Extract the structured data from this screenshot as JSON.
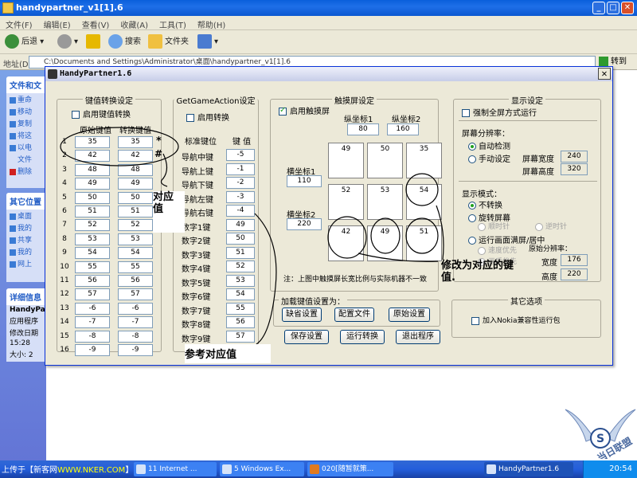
{
  "explorer": {
    "title": "handypartner_v1[1].6",
    "menu": [
      "文件(F)",
      "编辑(E)",
      "查看(V)",
      "收藏(A)",
      "工具(T)",
      "帮助(H)"
    ],
    "toolbar": {
      "back": "后退",
      "search": "搜索",
      "folders": "文件夹"
    },
    "address_label": "地址(D)",
    "address_value": "C:\\Documents and Settings\\Administrator\\桌面\\handypartner_v1[1].6",
    "go_label": "转到",
    "side": {
      "tasks_title": "文件和文",
      "tasks": [
        "重命",
        "移动",
        "复制",
        "将这",
        "以电",
        "文件",
        "删除"
      ],
      "other_title": "其它位置",
      "other": [
        "桌面",
        "我的",
        "共享",
        "我的",
        "网上"
      ],
      "details_title": "详细信息",
      "details": [
        "HandyPar",
        "应用程序",
        "修改日期",
        "15:28",
        "大小: 2"
      ]
    }
  },
  "app": {
    "title": "HandyPartner1.6",
    "keymap": {
      "group_title": "键值转换设定",
      "enable_label": "启用键值转换",
      "enabled": false,
      "col_original": "原始键值",
      "col_converted": "转换键值",
      "rows": [
        {
          "n": "1",
          "orig": "35",
          "conv": "35"
        },
        {
          "n": "2",
          "orig": "42",
          "conv": "42"
        },
        {
          "n": "3",
          "orig": "48",
          "conv": "48"
        },
        {
          "n": "4",
          "orig": "49",
          "conv": "49"
        },
        {
          "n": "5",
          "orig": "50",
          "conv": "50"
        },
        {
          "n": "6",
          "orig": "51",
          "conv": "51"
        },
        {
          "n": "7",
          "orig": "52",
          "conv": "52"
        },
        {
          "n": "8",
          "orig": "53",
          "conv": "53"
        },
        {
          "n": "9",
          "orig": "54",
          "conv": "54"
        },
        {
          "n": "10",
          "orig": "55",
          "conv": "55"
        },
        {
          "n": "11",
          "orig": "56",
          "conv": "56"
        },
        {
          "n": "12",
          "orig": "57",
          "conv": "57"
        },
        {
          "n": "13",
          "orig": "-6",
          "conv": "-6"
        },
        {
          "n": "14",
          "orig": "-7",
          "conv": "-7"
        },
        {
          "n": "15",
          "orig": "-8",
          "conv": "-8"
        },
        {
          "n": "16",
          "orig": "-9",
          "conv": "-9"
        }
      ]
    },
    "gameaction": {
      "group_title": "GetGameAction设定",
      "enable_label": "启用转换",
      "enabled": false,
      "col_key": "标准键位",
      "col_value": "键 值",
      "rows": [
        {
          "label": "导航中键",
          "value": "-5"
        },
        {
          "label": "导航上键",
          "value": "-1"
        },
        {
          "label": "导航下键",
          "value": "-2"
        },
        {
          "label": "导航左键",
          "value": "-3"
        },
        {
          "label": "导航右键",
          "value": "-4"
        },
        {
          "label": "数字1键",
          "value": "49"
        },
        {
          "label": "数字2键",
          "value": "50"
        },
        {
          "label": "数字3键",
          "value": "51"
        },
        {
          "label": "数字4键",
          "value": "52"
        },
        {
          "label": "数字5键",
          "value": "53"
        },
        {
          "label": "数字6键",
          "value": "54"
        },
        {
          "label": "数字7键",
          "value": "55"
        },
        {
          "label": "数字8键",
          "value": "56"
        },
        {
          "label": "数字9键",
          "value": "57"
        }
      ]
    },
    "touch": {
      "group_title": "触摸屏设定",
      "enable_label": "启用触摸屏",
      "enabled": true,
      "y1_label": "纵坐标1",
      "y1": "80",
      "y2_label": "纵坐标2",
      "y2": "160",
      "x1_label": "横坐标1",
      "x1": "110",
      "x2_label": "横坐标2",
      "x2": "220",
      "grid": [
        "49",
        "50",
        "35",
        "52",
        "53",
        "54",
        "42",
        "49",
        "51"
      ],
      "note": "注：上图中触摸屏长宽比例与实际机器不一致"
    },
    "display": {
      "group_title": "显示设定",
      "force_full_label": "强制全屏方式运行",
      "force_full": false,
      "resolution_title": "屏幕分辨率：",
      "auto_label": "自动检测",
      "manual_label": "手动设定",
      "resolution_mode": "auto",
      "width_label": "屏幕宽度",
      "width": "240",
      "height_label": "屏幕高度",
      "height": "320",
      "mode_title": "显示模式：",
      "no_convert_label": "不转换",
      "rotate_label": "旋转屏幕",
      "clockwise_label": "顺时针",
      "counter_label": "逆时针",
      "fullscreen_label": "运行画面满屏/居中",
      "speed_label": "速度优先",
      "quality_label": "画质优先",
      "display_mode": "none",
      "orig_res_label": "原始分辨率：",
      "orig_width_label": "宽度",
      "orig_width": "176",
      "orig_height_label": "高度",
      "orig_height": "220"
    },
    "load": {
      "group_title": "加载键值设置为：",
      "default_btn": "缺省设置",
      "config_btn": "配置文件",
      "original_btn": "原始设置"
    },
    "other": {
      "group_title": "其它选项",
      "nokia_label": "加入Nokia兼容性运行包",
      "nokia": false
    },
    "actions": {
      "save": "保存设置",
      "run": "运行转换",
      "exit": "退出程序"
    }
  },
  "annotations": {
    "star": "*",
    "hash": "#",
    "corresponding": "对应\n值",
    "reference": "参考对应值",
    "modify": "修改为对应的键\n值."
  },
  "taskbar": {
    "upload_prefix": "上传于【新客网",
    "upload_url": "WWW.NKER.COM",
    "upload_suffix": "】",
    "items": [
      "11 Internet ...",
      "5 Windows Ex...",
      "020[随暂就策...",
      "HandyPartner1.6"
    ],
    "clock": "20:54"
  },
  "watermark": {
    "text": "当日联盟",
    "site": "www.youxue.com"
  }
}
